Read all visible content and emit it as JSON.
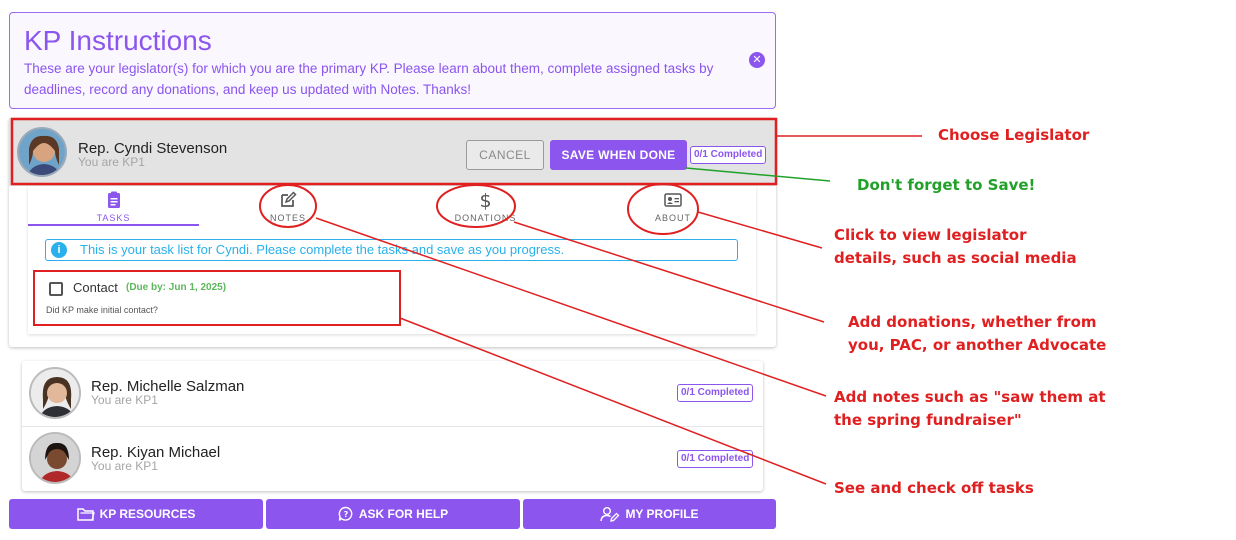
{
  "instructions": {
    "title": "KP Instructions",
    "text": "These are your legislator(s) for which you are the primary KP. Please learn about them, complete assigned tasks by deadlines, record any donations, and keep us updated with Notes. Thanks!",
    "close_icon": "close-circle-icon"
  },
  "active_legislator": {
    "name": "Rep. Cyndi Stevenson",
    "role": "You are KP1",
    "cancel_label": "CANCEL",
    "save_label": "SAVE WHEN DONE",
    "completed": "0/1 Completed"
  },
  "tabs": [
    {
      "label": "TASKS",
      "icon": "clipboard-icon",
      "active": true
    },
    {
      "label": "NOTES",
      "icon": "edit-icon",
      "active": false
    },
    {
      "label": "DONATIONS",
      "icon": "dollar-icon",
      "active": false
    },
    {
      "label": "ABOUT",
      "icon": "contact-card-icon",
      "active": false
    }
  ],
  "info_message": "This is your task list for Cyndi. Please complete the tasks and save as you progress.",
  "task": {
    "title": "Contact",
    "due": "(Due by: Jun 1, 2025)",
    "description": "Did KP make initial contact?"
  },
  "legislators": [
    {
      "name": "Rep. Michelle Salzman",
      "role": "You are KP1",
      "completed": "0/1 Completed"
    },
    {
      "name": "Rep. Kiyan Michael",
      "role": "You are KP1",
      "completed": "0/1 Completed"
    }
  ],
  "bottom_buttons": [
    {
      "label": "KP RESOURCES",
      "icon": "folder-icon"
    },
    {
      "label": "ASK FOR HELP",
      "icon": "chat-help-icon"
    },
    {
      "label": "MY PROFILE",
      "icon": "user-edit-icon"
    }
  ],
  "annotations": {
    "choose": "Choose Legislator",
    "save": "Don't forget to Save!",
    "about_1": "Click to view legislator",
    "about_2": "details, such as social media",
    "donations_1": "Add donations, whether from",
    "donations_2": "you, PAC, or another Advocate",
    "notes_1": "Add notes such as \"saw them at",
    "notes_2": "the spring fundraiser\"",
    "tasks": "See and check off tasks"
  },
  "colors": {
    "accent": "#8b55ee",
    "info": "#2ab0ea",
    "annotation": "#e02020",
    "annotation_green": "#22a12a",
    "due": "#5cb85c"
  }
}
